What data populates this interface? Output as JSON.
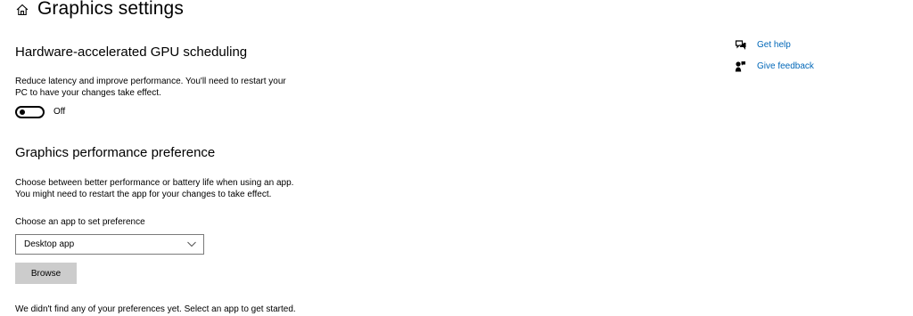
{
  "header": {
    "title": "Graphics settings",
    "home_icon": "home-icon"
  },
  "gpu_scheduling": {
    "heading": "Hardware-accelerated GPU scheduling",
    "description_line1": "Reduce latency and improve performance. You'll need to restart your",
    "description_line2": "PC to have your changes take effect.",
    "toggle_state": "Off",
    "toggle_on": false
  },
  "performance_preference": {
    "heading": "Graphics performance preference",
    "description_line1": "Choose between better performance or battery life when using an app.",
    "description_line2": "You might need to restart the app for your changes to take effect.",
    "choose_label": "Choose an app to set preference",
    "dropdown_value": "Desktop app",
    "browse_label": "Browse",
    "status_text": "We didn't find any of your preferences yet. Select an app to get started."
  },
  "side_links": {
    "get_help": "Get help",
    "give_feedback": "Give feedback"
  },
  "colors": {
    "link": "#0067b8",
    "button_bg": "#cccccc",
    "dropdown_border": "#7a7a7a"
  }
}
